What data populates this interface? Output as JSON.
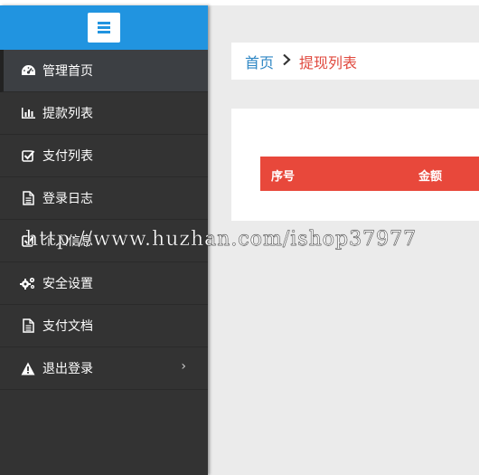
{
  "sidebar": {
    "items": [
      {
        "label": "管理首页",
        "icon": "dashboard-icon"
      },
      {
        "label": "提款列表",
        "icon": "bar-chart-icon"
      },
      {
        "label": "支付列表",
        "icon": "check-square-icon"
      },
      {
        "label": "登录日志",
        "icon": "document-icon"
      },
      {
        "label": "个人信息",
        "icon": "check-square-icon"
      },
      {
        "label": "安全设置",
        "icon": "gears-icon"
      },
      {
        "label": "支付文档",
        "icon": "document-icon"
      },
      {
        "label": "退出登录",
        "icon": "warning-icon"
      }
    ],
    "colors": {
      "header": "#2194e0",
      "background": "#333333"
    }
  },
  "breadcrumb": {
    "home": "首页",
    "current": "提现列表"
  },
  "table": {
    "columns": [
      "序号",
      "金额"
    ],
    "header_color": "#e8483b"
  },
  "watermark": "http://www.huzhan.com/ishop37977"
}
